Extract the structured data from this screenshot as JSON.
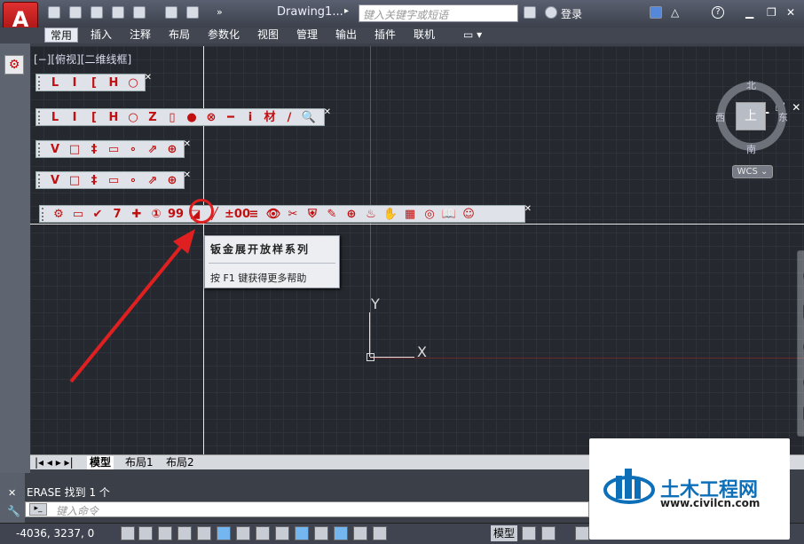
{
  "titlebar": {
    "app_button_label": "A",
    "doc_title": "Drawing1...",
    "search_placeholder": "键入关键字或短语",
    "login_label": "登录",
    "help_label": "?"
  },
  "ribbon_tabs": [
    "常用",
    "插入",
    "注释",
    "布局",
    "参数化",
    "视图",
    "管理",
    "输出",
    "插件",
    "联机"
  ],
  "viewport": {
    "label": "[−][俯视][二维线框]",
    "ucs_y": "Y",
    "ucs_x": "X"
  },
  "toolbars": [
    {
      "items": [
        "L",
        "I",
        "[",
        "H",
        "○"
      ]
    },
    {
      "items": [
        "L",
        "I",
        "[",
        "H",
        "○",
        "Z",
        "▯",
        "●",
        "⊗",
        "━",
        "ⅰ",
        "材",
        "∕",
        "🔍"
      ]
    },
    {
      "items": [
        "Ⅴ",
        "□",
        "‡",
        "▭",
        "∘",
        "⇗",
        "⊕"
      ]
    },
    {
      "items": [
        "Ⅴ",
        "□",
        "‡",
        "▭",
        "∘",
        "⇗",
        "⊕"
      ]
    },
    {
      "items": [
        "⚙",
        "▭",
        "✔",
        "7",
        "✚",
        "①",
        "99",
        "◪",
        "╱",
        "±00",
        "≡",
        "👁",
        "✂",
        "⛨",
        "✎",
        "⊕",
        "♨",
        "✋",
        "▦",
        "◎",
        "📖",
        "☺"
      ]
    }
  ],
  "tooltip": {
    "title": "钣金展开放样系列",
    "help": "按 F1 键获得更多帮助"
  },
  "viewcube": {
    "north": "北",
    "south": "南",
    "east": "东",
    "west": "西",
    "face": "上",
    "wcs": "WCS ⌄"
  },
  "layout_tabs": [
    "模型",
    "布局1",
    "布局2"
  ],
  "command": {
    "history": "ERASE 找到 1 个",
    "placeholder": "键入命令"
  },
  "status": {
    "coords": "-4036, 3237, 0",
    "model_label": "模型"
  },
  "watermark": {
    "name": "土木工程网",
    "url": "www.civilcn.com"
  },
  "colors": {
    "accent_red": "#e02020",
    "viewport_bg": "#25292f",
    "watermark_blue": "#0e6fb9"
  }
}
